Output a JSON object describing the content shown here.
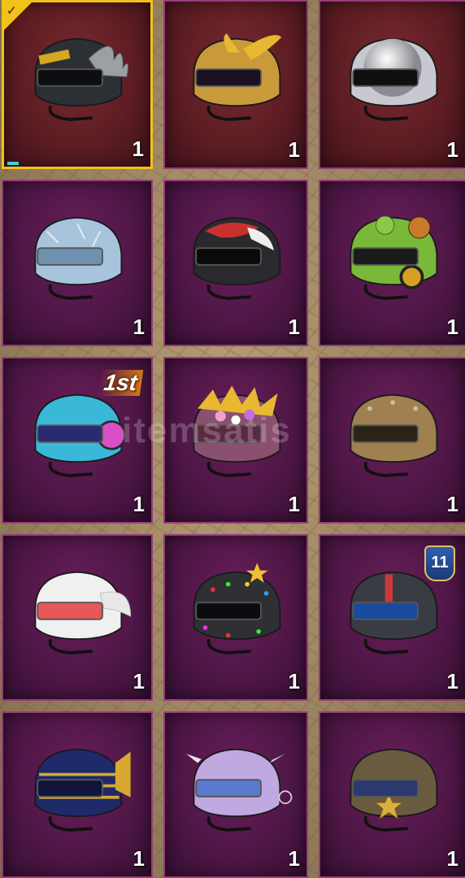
{
  "inventory": {
    "items": [
      {
        "name": "winged-lightweight-helmet",
        "count": "1",
        "bg": "red",
        "selected": true,
        "primary": "#2c3034",
        "accent": "#d4a820",
        "visor": "#0e0e10"
      },
      {
        "name": "golden-samurai-helmet",
        "count": "1",
        "bg": "red",
        "selected": false,
        "primary": "#c89a3a",
        "accent": "#8a6ad0",
        "visor": "#1a1220"
      },
      {
        "name": "disco-ball-helmet",
        "count": "1",
        "bg": "red",
        "selected": false,
        "primary": "#c8c8d0",
        "accent": "#ffffff",
        "visor": "#101010"
      },
      {
        "name": "ice-crystal-helmet",
        "count": "1",
        "bg": "purple",
        "selected": false,
        "primary": "#a8c4dc",
        "accent": "#e0f0ff",
        "visor": "#7090b0"
      },
      {
        "name": "red-white-graffiti-helmet",
        "count": "1",
        "bg": "purple",
        "selected": false,
        "primary": "#2a2a2e",
        "accent": "#c8322e",
        "visor": "#0a0a0a"
      },
      {
        "name": "frog-gas-mask-helmet",
        "count": "1",
        "bg": "purple",
        "selected": false,
        "primary": "#7ab83a",
        "accent": "#c84a2a",
        "visor": "#1a1a1a"
      },
      {
        "name": "cyan-headphone-helmet",
        "count": "1",
        "bg": "purple",
        "selected": false,
        "primary": "#3ab8d8",
        "accent": "#d850c8",
        "visor": "#2a2a70",
        "badge": "1st"
      },
      {
        "name": "flower-crown-helmet",
        "count": "1",
        "bg": "purple",
        "selected": false,
        "primary": "#8a5070",
        "accent": "#e8b830",
        "visor": "#5a2a40"
      },
      {
        "name": "bronze-rivet-helmet",
        "count": "1",
        "bg": "purple",
        "selected": false,
        "primary": "#a08050",
        "accent": "#7a8090",
        "visor": "#2a2418"
      },
      {
        "name": "white-bunny-helmet",
        "count": "1",
        "bg": "purple",
        "selected": false,
        "primary": "#f0f0f0",
        "accent": "#f07070",
        "visor": "#e85858"
      },
      {
        "name": "christmas-lights-helmet",
        "count": "1",
        "bg": "purple",
        "selected": false,
        "primary": "#2e3034",
        "accent": "#f0c030",
        "visor": "#0c0c0e"
      },
      {
        "name": "blue-tech-helmet",
        "count": "1",
        "bg": "purple",
        "selected": false,
        "primary": "#3a3c44",
        "accent": "#c83a3a",
        "visor": "#1a4aa0",
        "level": "11"
      },
      {
        "name": "pharaoh-helmet",
        "count": "1",
        "bg": "purple",
        "selected": false,
        "primary": "#1e2a6a",
        "accent": "#d8a830",
        "visor": "#101438"
      },
      {
        "name": "lavender-robot-helmet",
        "count": "1",
        "bg": "purple",
        "selected": false,
        "primary": "#c0a8e0",
        "accent": "#6ab8e8",
        "visor": "#5a7ad0"
      },
      {
        "name": "sheriff-star-helmet",
        "count": "1",
        "bg": "purple",
        "selected": false,
        "primary": "#6a5a40",
        "accent": "#d8b040",
        "visor": "#2a3a70"
      }
    ]
  },
  "watermark": "itemsatis"
}
